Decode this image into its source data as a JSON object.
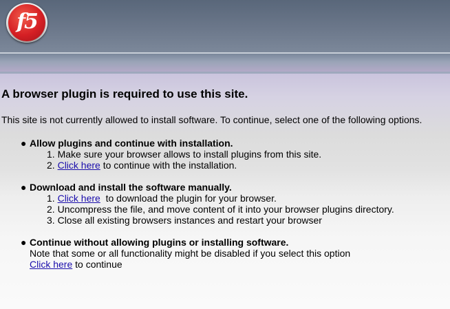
{
  "header": {
    "logo_text": "f5"
  },
  "main": {
    "heading": "A browser plugin is required to use this site.",
    "intro": "This site is not currently allowed to install software. To continue, select one of the following options.",
    "options": [
      {
        "title": "Allow plugins and continue with installation.",
        "steps": [
          {
            "num": "1.",
            "text": "Make sure your browser allows to install plugins from this site."
          },
          {
            "num": "2.",
            "link": "Click here",
            "text": " to continue with the installation."
          }
        ]
      },
      {
        "title": "Download and install the software manually.",
        "steps": [
          {
            "num": "1.",
            "link": "Click here",
            "text": "  to download the plugin for your browser."
          },
          {
            "num": "2.",
            "text": "Uncompress the file, and move content of it into your browser plugins directory."
          },
          {
            "num": "3.",
            "text": "Close all existing browsers instances and restart your browser"
          }
        ]
      },
      {
        "title": "Continue without allowing plugins or installing software.",
        "note": "Note that some or all functionality might be disabled if you select this option",
        "link": "Click here",
        "link_suffix": " to continue"
      }
    ]
  }
}
